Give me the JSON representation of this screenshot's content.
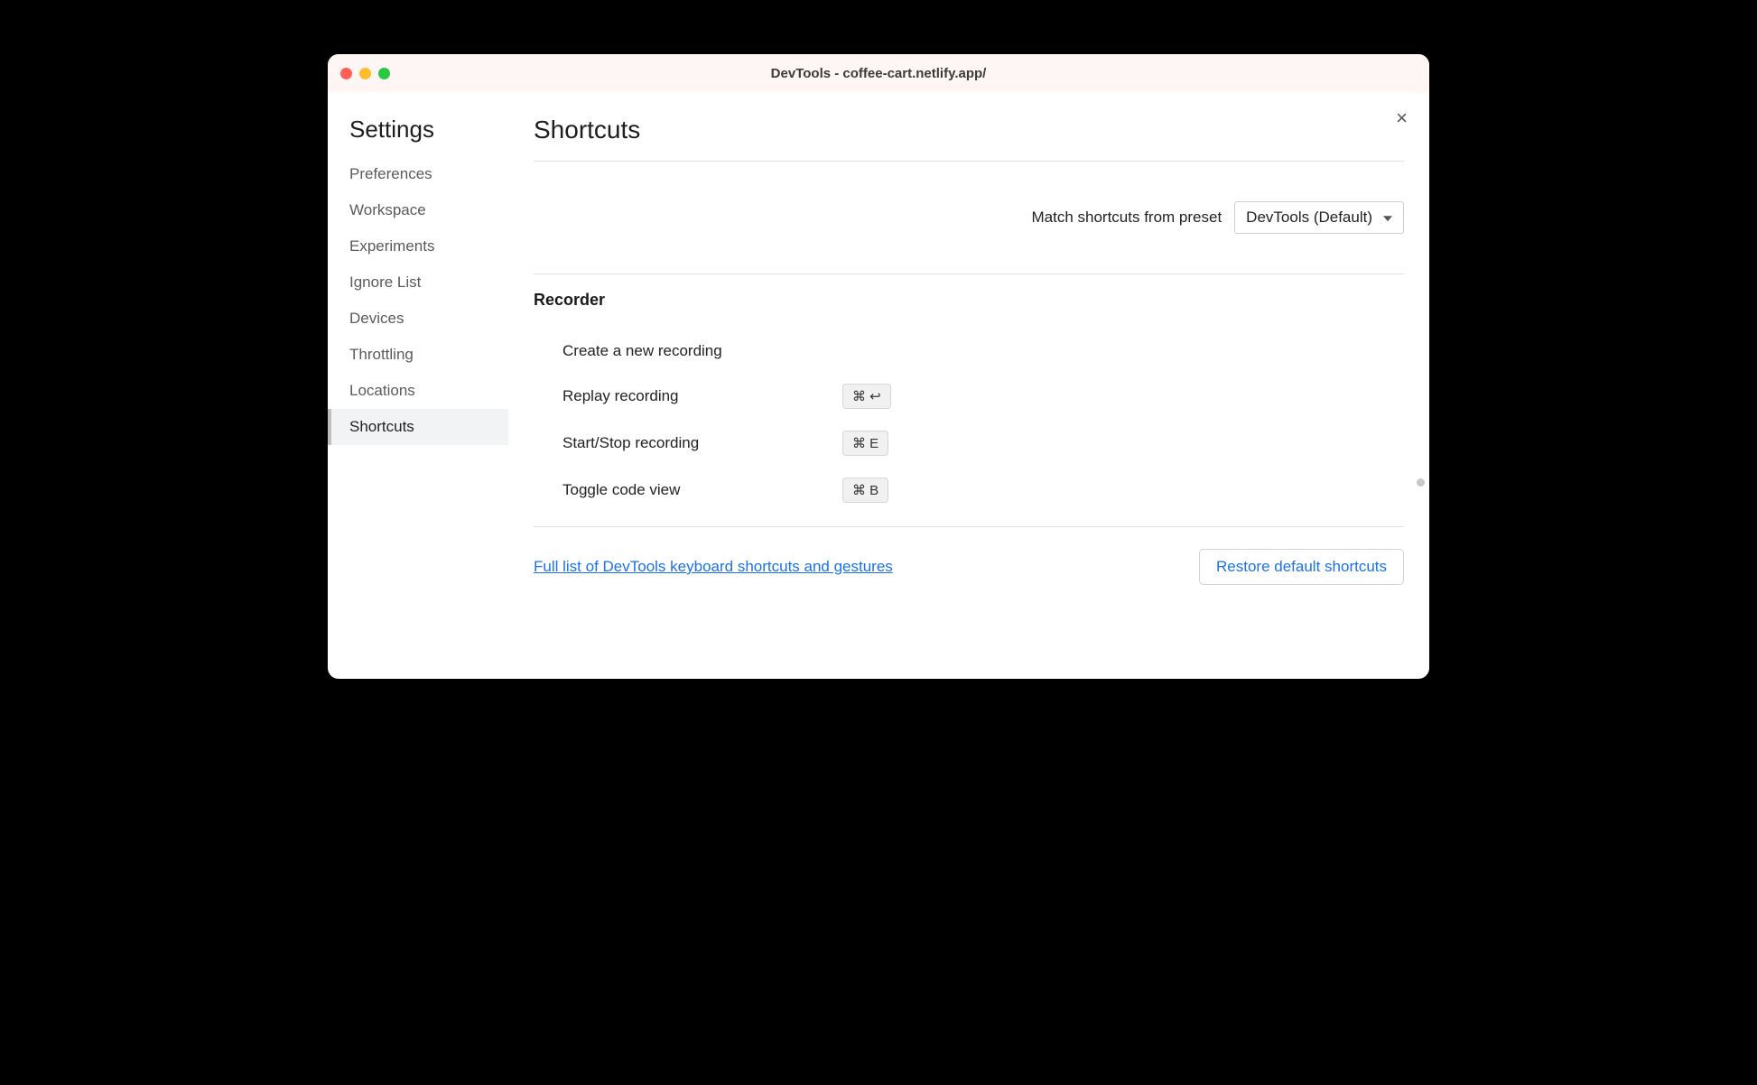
{
  "window": {
    "title": "DevTools - coffee-cart.netlify.app/"
  },
  "sidebar": {
    "heading": "Settings",
    "items": [
      {
        "label": "Preferences"
      },
      {
        "label": "Workspace"
      },
      {
        "label": "Experiments"
      },
      {
        "label": "Ignore List"
      },
      {
        "label": "Devices"
      },
      {
        "label": "Throttling"
      },
      {
        "label": "Locations"
      },
      {
        "label": "Shortcuts"
      }
    ]
  },
  "main": {
    "heading": "Shortcuts",
    "preset_label": "Match shortcuts from preset",
    "preset_value": "DevTools (Default)",
    "section_title": "Recorder",
    "rows": [
      {
        "label": "Create a new recording",
        "keys": ""
      },
      {
        "label": "Replay recording",
        "keys": "⌘  ↩"
      },
      {
        "label": "Start/Stop recording",
        "keys": "⌘  E"
      },
      {
        "label": "Toggle code view",
        "keys": "⌘  B"
      }
    ],
    "full_list_link": "Full list of DevTools keyboard shortcuts and gestures",
    "restore_button": "Restore default shortcuts"
  }
}
